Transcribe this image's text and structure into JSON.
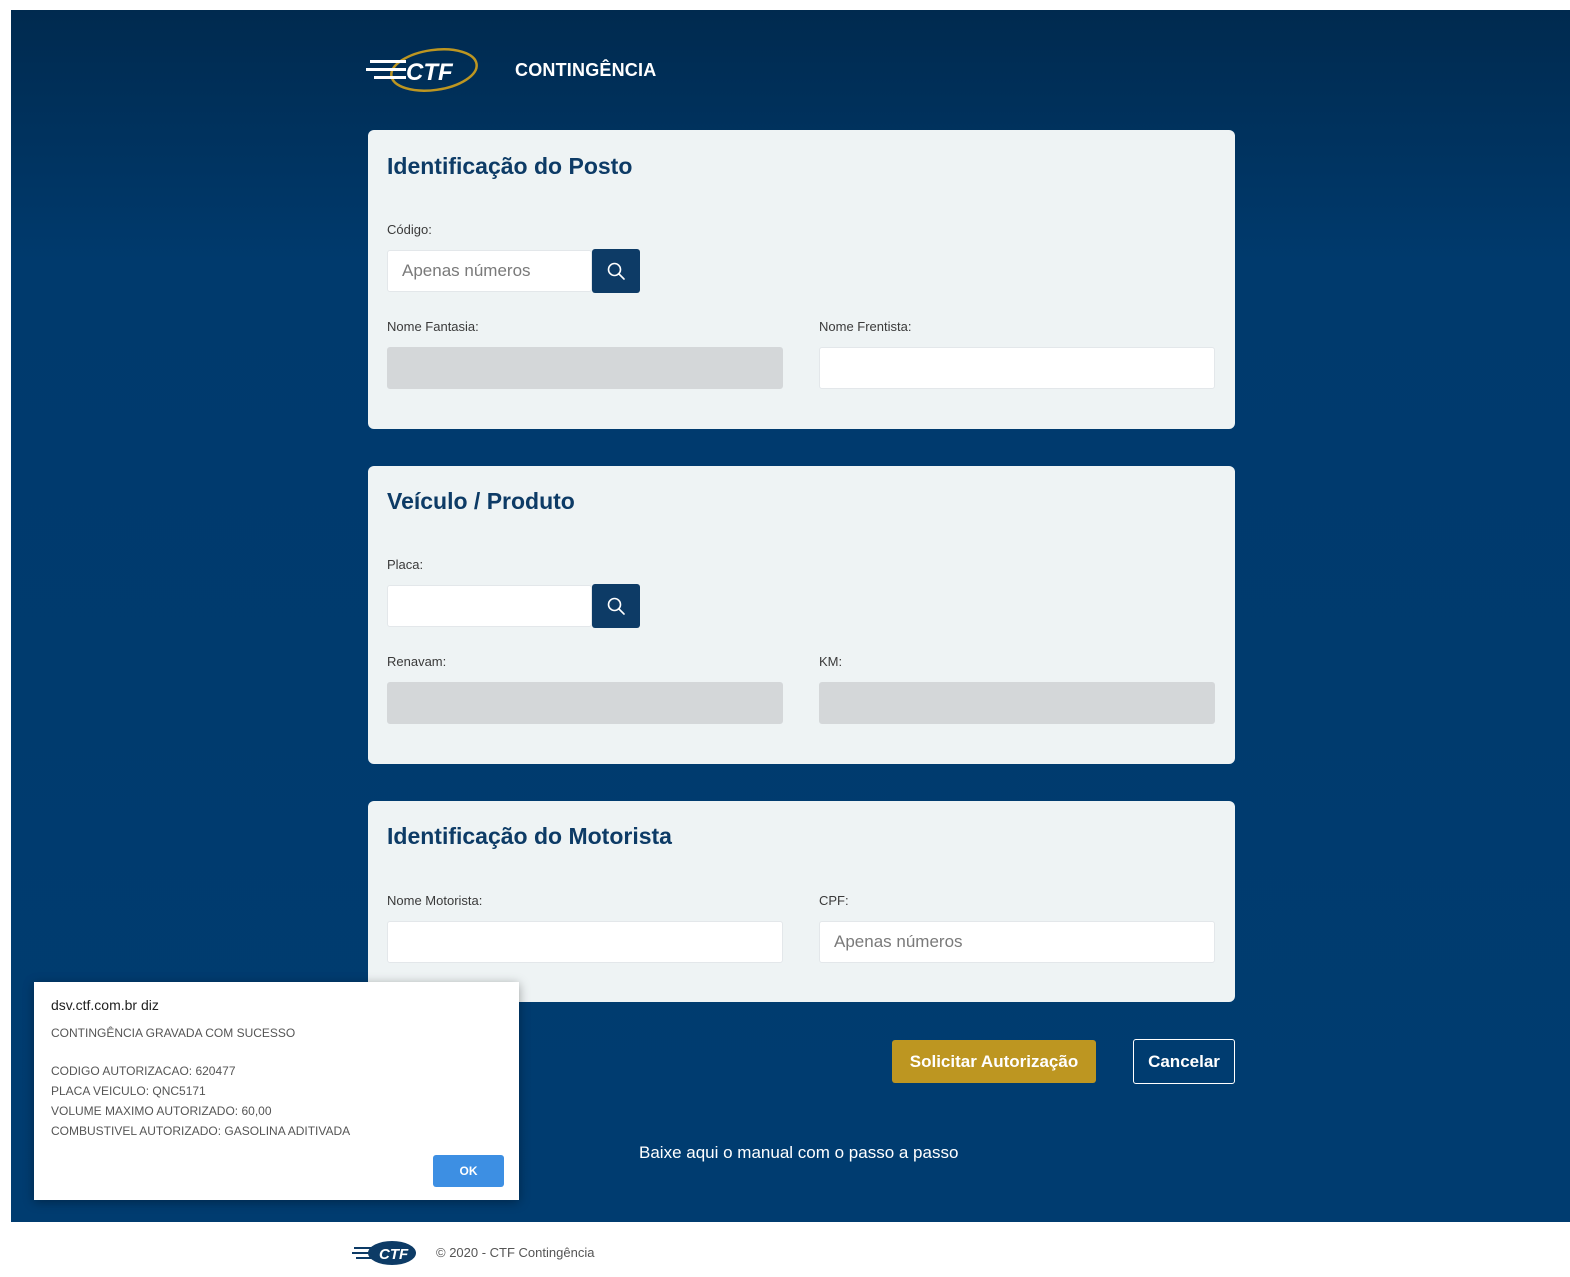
{
  "header": {
    "logo_text": "CTF",
    "title": "CONTINGÊNCIA"
  },
  "posto": {
    "title": "Identificação do Posto",
    "codigo_label": "Código:",
    "codigo_placeholder": "Apenas números",
    "nome_fantasia_label": "Nome Fantasia:",
    "nome_frentista_label": "Nome Frentista:"
  },
  "veiculo": {
    "title": "Veículo / Produto",
    "placa_label": "Placa:",
    "renavam_label": "Renavam:",
    "km_label": "KM:"
  },
  "motorista": {
    "title": "Identificação do Motorista",
    "nome_label": "Nome Motorista:",
    "cpf_label": "CPF:",
    "cpf_placeholder": "Apenas números"
  },
  "actions": {
    "submit_label": "Solicitar Autorização",
    "cancel_label": "Cancelar",
    "manual_link": "Baixe aqui o manual com o passo a passo"
  },
  "footer": {
    "text": "© 2020 - CTF Contingência"
  },
  "dialog": {
    "title": "dsv.ctf.com.br diz",
    "line1": "CONTINGÊNCIA GRAVADA COM SUCESSO",
    "line2": "CODIGO AUTORIZACAO: 620477",
    "line3": "PLACA VEICULO: QNC5171",
    "line4": "VOLUME MAXIMO AUTORIZADO: 60,00",
    "line5": "COMBUSTIVEL AUTORIZADO: GASOLINA ADITIVADA",
    "ok_label": "OK"
  },
  "colors": {
    "background": "#003a6d",
    "primary": "#0d3b66",
    "gold": "#bd9621",
    "card": "#eef3f4",
    "dialog_button": "#3d8fe3"
  },
  "icons": {
    "search": "search-icon",
    "logo": "ctf-logo"
  }
}
